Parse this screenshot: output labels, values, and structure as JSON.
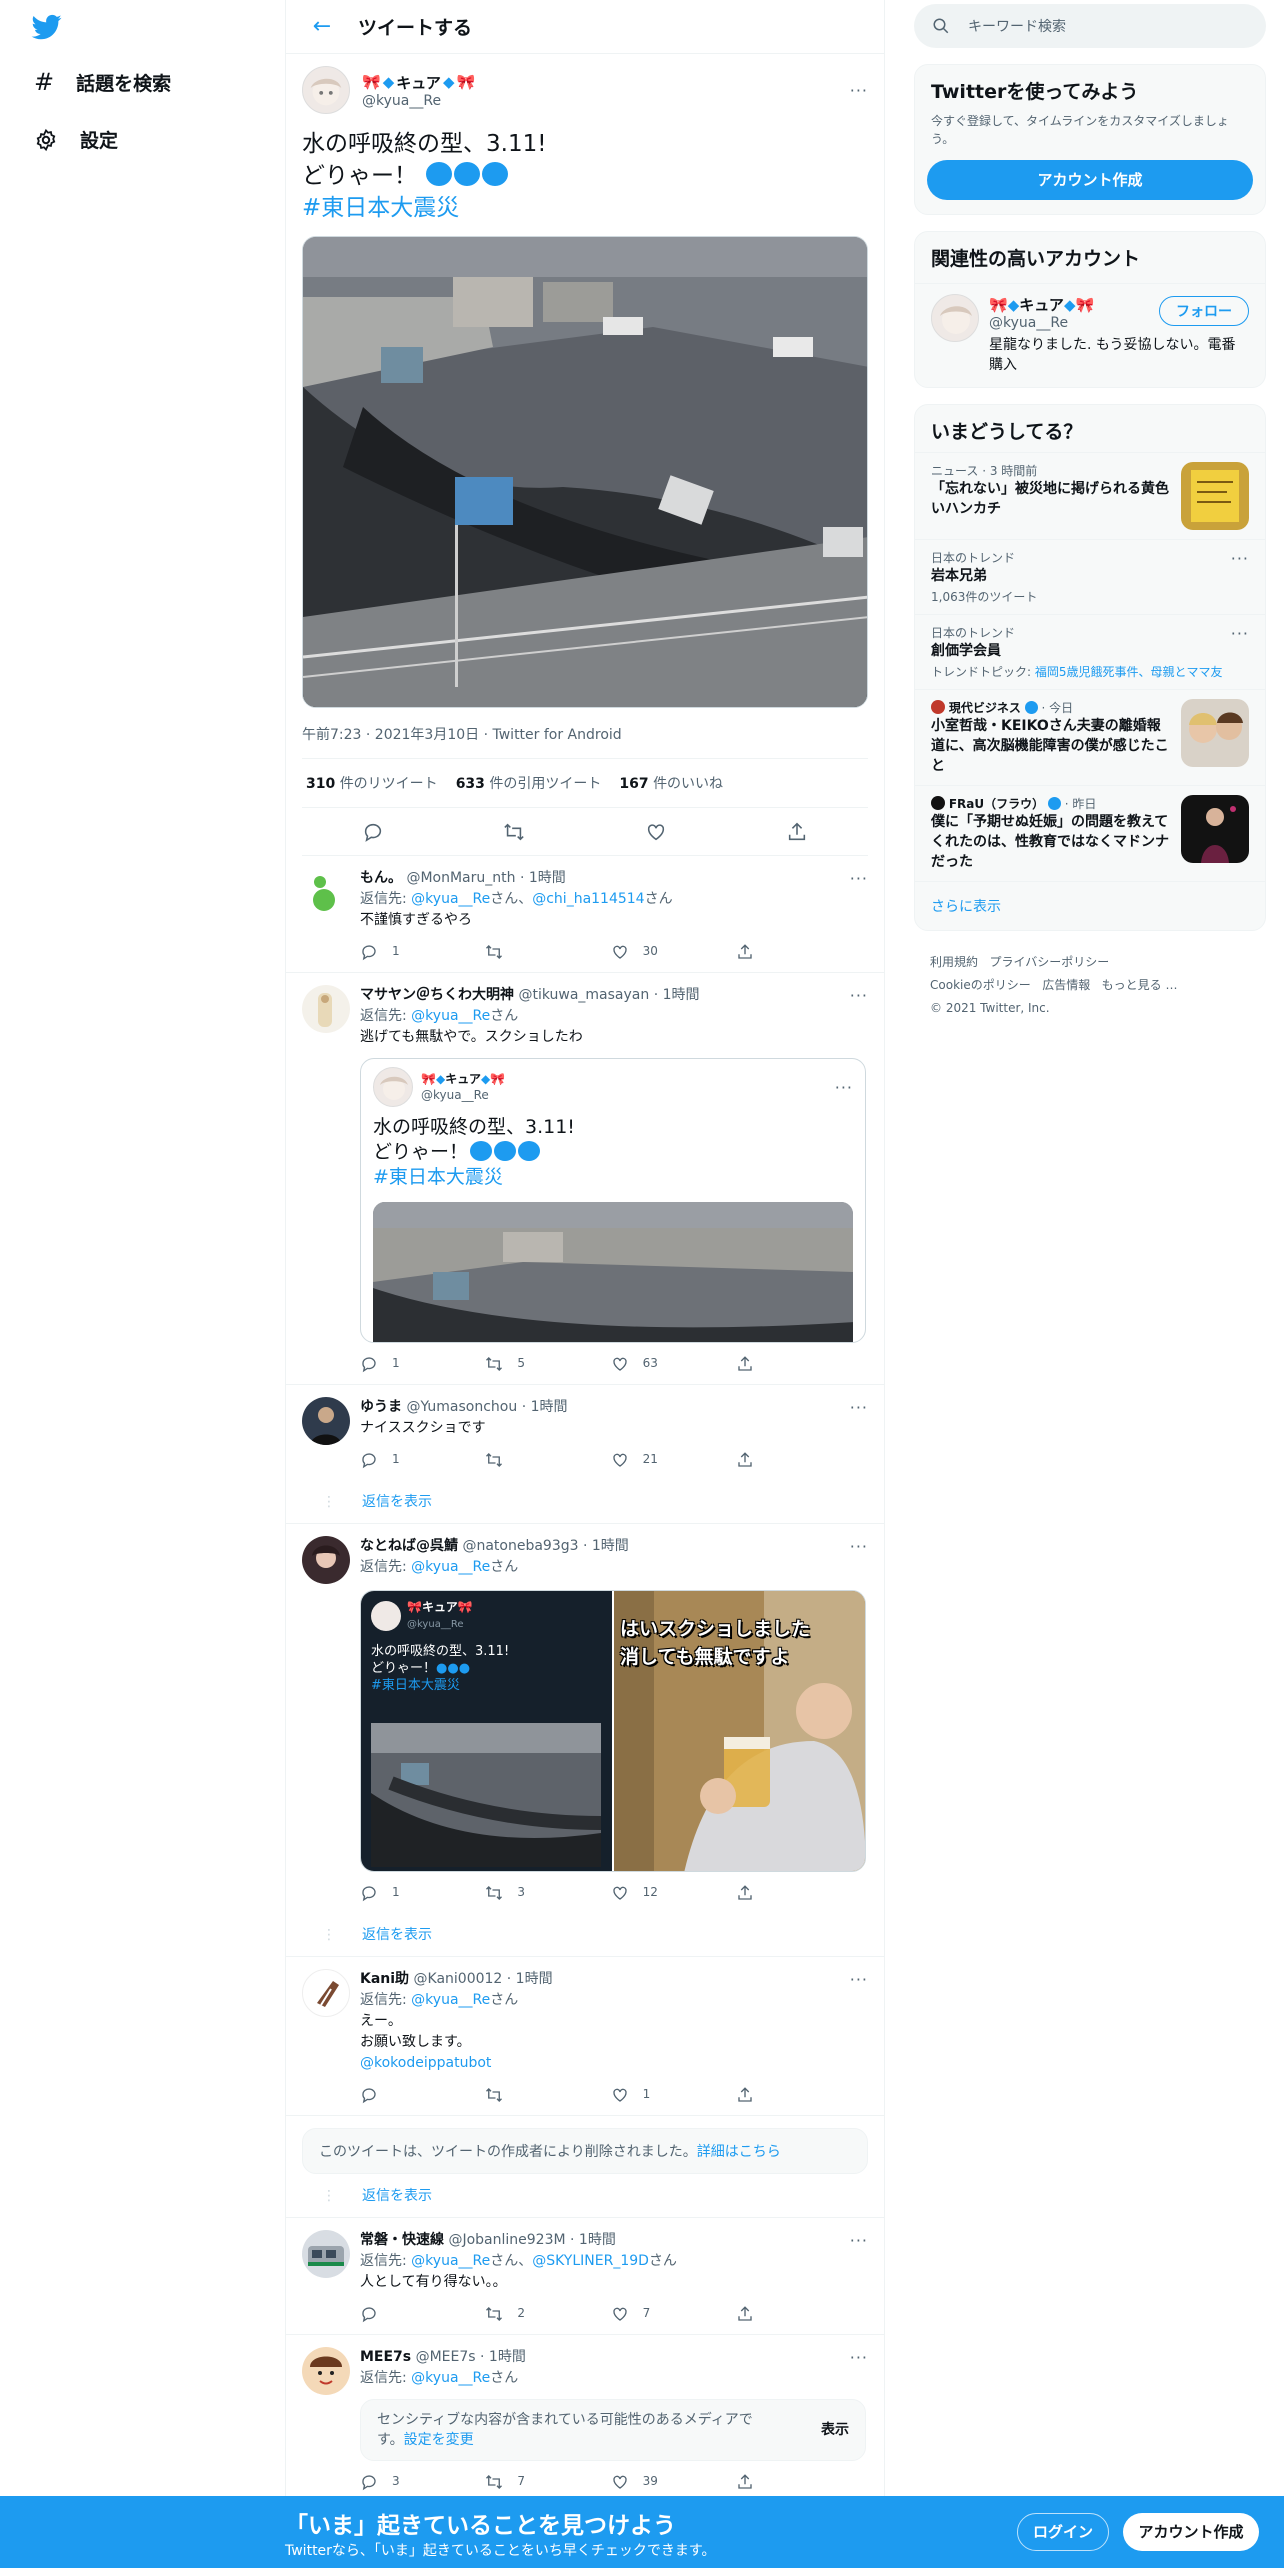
{
  "nav": {
    "explore_label": "話題を検索",
    "settings_label": "設定"
  },
  "header": {
    "title": "ツイートする"
  },
  "tweet": {
    "name": "キュア",
    "handle": "@kyua__Re",
    "line1": "水の呼吸終の型、3.11!",
    "line2": "どりゃー！",
    "hashtag": "#東日本大震災",
    "meta": "午前7:23 · 2021年3月10日 · Twitter for Android",
    "retweets_count": "310",
    "retweets_label": "件のリツイート",
    "quotes_count": "633",
    "quotes_label": "件の引用ツイート",
    "likes_count": "167",
    "likes_label": "件のいいね"
  },
  "replying_to_label": "返信先:",
  "san": "さん",
  "comma": "、",
  "show_replies": "返信を表示",
  "replies": [
    {
      "name": "もん。",
      "handle": "@MonMaru_nth",
      "time": "· 1時間",
      "to1": "@kyua__Re",
      "to2": "@chi_ha114514",
      "text": "不謹慎すぎるやろ",
      "reply_count": "1",
      "rt_count": "",
      "like_count": "30"
    },
    {
      "name": "マサヤン＠ちくわ大明神",
      "handle": "@tikuwa_masayan",
      "time": "· 1時間",
      "to1": "@kyua__Re",
      "text": "逃げても無駄やで。スクショしたわ",
      "reply_count": "1",
      "rt_count": "5",
      "like_count": "63"
    },
    {
      "name": "ゆうま",
      "handle": "@Yumasonchou",
      "time": "· 1時間",
      "text": "ナイススクショです",
      "reply_count": "1",
      "rt_count": "",
      "like_count": "21"
    },
    {
      "name": "なとねば@呉鯖",
      "handle": "@natoneba93g3",
      "time": "· 1時間",
      "to1": "@kyua__Re",
      "reply_count": "1",
      "rt_count": "3",
      "like_count": "12"
    },
    {
      "name": "Kani助",
      "handle": "@Kani00012",
      "time": "· 1時間",
      "to1": "@kyua__Re",
      "text1": "えー。",
      "text2": "お願い致します。",
      "mention": "@kokodeippatubot",
      "reply_count": "",
      "rt_count": "",
      "like_count": "1"
    },
    {
      "name": "常磐・快速線",
      "handle": "@Jobanline923M",
      "time": "· 1時間",
      "to1": "@kyua__Re",
      "to2": "@SKYLINER_19D",
      "text": "人として有り得ない。。",
      "reply_count": "",
      "rt_count": "2",
      "like_count": "7"
    },
    {
      "name": "MEE7s",
      "handle": "@MEE7s",
      "time": "· 1時間",
      "to1": "@kyua__Re",
      "reply_count": "3",
      "rt_count": "7",
      "like_count": "39"
    }
  ],
  "quoted": {
    "name": "キュア",
    "handle": "@kyua__Re",
    "line1": "水の呼吸終の型、3.11!",
    "line2": "どりゃー！",
    "hashtag": "#東日本大震災"
  },
  "screenshot_text": {
    "name": "キュア",
    "handle": "@kyua__Re",
    "line1": "水の呼吸終の型、3.11!",
    "line2": "どりゃー！",
    "hashtag": "#東日本大震災",
    "overlay1": "はいスクショしました",
    "overlay2": "消しても無駄ですよ"
  },
  "deleted": {
    "text": "このツイートは、ツイートの作成者により削除されました。",
    "link": "詳細はこちら"
  },
  "sensitive": {
    "text1": "センシティブな内容が含まれている可能性のあるメディアで",
    "text2": "す。",
    "link": "設定を変更",
    "button": "表示"
  },
  "sidebar": {
    "search_placeholder": "キーワード検索",
    "signup_title": "Twitterを使ってみよう",
    "signup_text": "今すぐ登録して、タイムラインをカスタマイズしましょう。",
    "signup_button": "アカウント作成",
    "related_title": "関連性の高いアカウント",
    "related_name": "キュア",
    "related_handle": "@kyua__Re",
    "related_bio": "星龍なりました. もう妥協しない。電番購入",
    "follow_button": "フォロー",
    "trends_title": "いまどうしてる？",
    "trends": [
      {
        "meta": "ニュース · 3 時間前",
        "title": "「忘れない」被災地に掲げられる黄色いハンカチ"
      },
      {
        "meta": "日本のトレンド",
        "title": "岩本兄弟",
        "count": "1,063件のツイート"
      },
      {
        "meta": "日本のトレンド",
        "title": "創価学会員",
        "topic_label": "トレンドトピック:",
        "topic": "福岡5歳児餓死事件、母親とママ友"
      },
      {
        "source": "現代ビジネス",
        "when": "· 今日",
        "title": "小室哲哉・KEIKOさん夫妻の離婚報道に、高次脳機能障害の僕が感じたこと"
      },
      {
        "source": "FRaU（フラウ）",
        "when": "· 昨日",
        "title": "僕に「予期せぬ妊娠」の問題を教えてくれたのは、性教育ではなくマドンナだった"
      }
    ],
    "show_more": "さらに表示",
    "footer": [
      "利用規約",
      "プライバシーポリシー",
      "Cookieのポリシー",
      "広告情報",
      "もっと見る …"
    ],
    "copyright": "© 2021 Twitter, Inc."
  },
  "bottom_bar": {
    "title": "「いま」起きていることを見つけよう",
    "subtitle": "Twitterなら、「いま」起きていることをいち早くチェックできます。",
    "login": "ログイン",
    "signup": "アカウント作成"
  },
  "colors": {
    "accent": "#1d9bf0",
    "text": "#0f1419",
    "muted": "#536471"
  }
}
